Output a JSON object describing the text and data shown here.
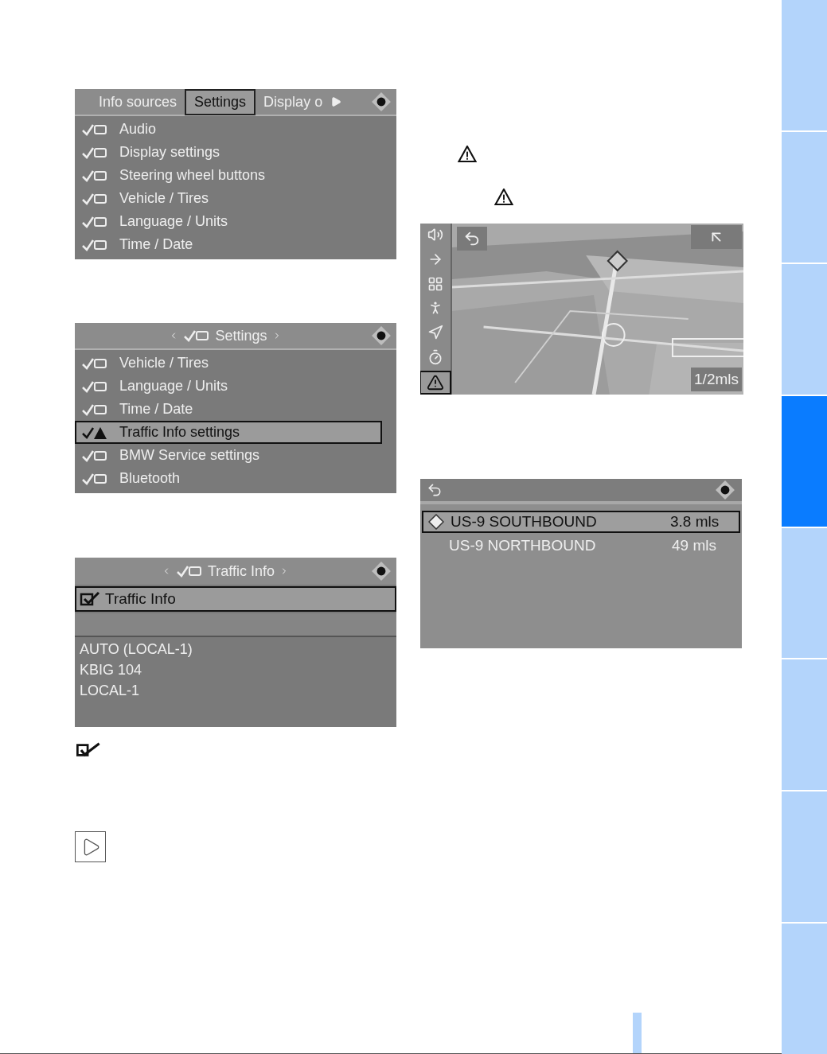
{
  "screens": [
    {
      "kind": "menu",
      "tabs": [
        {
          "label": "Info sources",
          "selected": false
        },
        {
          "label": "Settings",
          "selected": true
        },
        {
          "label": "Display o",
          "selected": false
        }
      ],
      "items": [
        {
          "label": "Audio",
          "selected": false
        },
        {
          "label": "Display settings",
          "selected": false
        },
        {
          "label": "Steering wheel buttons",
          "selected": false
        },
        {
          "label": "Vehicle / Tires",
          "selected": false
        },
        {
          "label": "Language / Units",
          "selected": false
        },
        {
          "label": "Time / Date",
          "selected": false
        }
      ]
    },
    {
      "kind": "menu",
      "title": "Settings",
      "items": [
        {
          "label": "Vehicle / Tires",
          "selected": false
        },
        {
          "label": "Language / Units",
          "selected": false
        },
        {
          "label": "Time / Date",
          "selected": false
        },
        {
          "label": "Traffic Info settings",
          "selected": true
        },
        {
          "label": "BMW Service settings",
          "selected": false
        },
        {
          "label": "Bluetooth",
          "selected": false
        }
      ]
    },
    {
      "kind": "traffic",
      "title": "Traffic Info",
      "option": {
        "label": "Traffic Info",
        "checked": true
      },
      "stations": [
        "AUTO (LOCAL-1)",
        "KBIG 104",
        "LOCAL-1"
      ]
    }
  ],
  "map": {
    "scale": "1/2mls",
    "tools": [
      {
        "selected": false
      },
      {
        "selected": false
      },
      {
        "selected": false
      },
      {
        "selected": false
      },
      {
        "selected": false
      },
      {
        "selected": false
      },
      {
        "selected": true
      }
    ]
  },
  "messages": {
    "rows": [
      {
        "name": "US-9 SOUTHBOUND",
        "distance": "3.8 mls",
        "selected": true
      },
      {
        "name": "US-9 NORTHBOUND",
        "distance": "49 mls",
        "selected": false
      }
    ]
  },
  "page_tabs": [
    {
      "selected": false
    },
    {
      "selected": false
    },
    {
      "selected": false
    },
    {
      "selected": true
    },
    {
      "selected": false
    },
    {
      "selected": false
    },
    {
      "selected": false
    },
    {
      "selected": false
    }
  ]
}
